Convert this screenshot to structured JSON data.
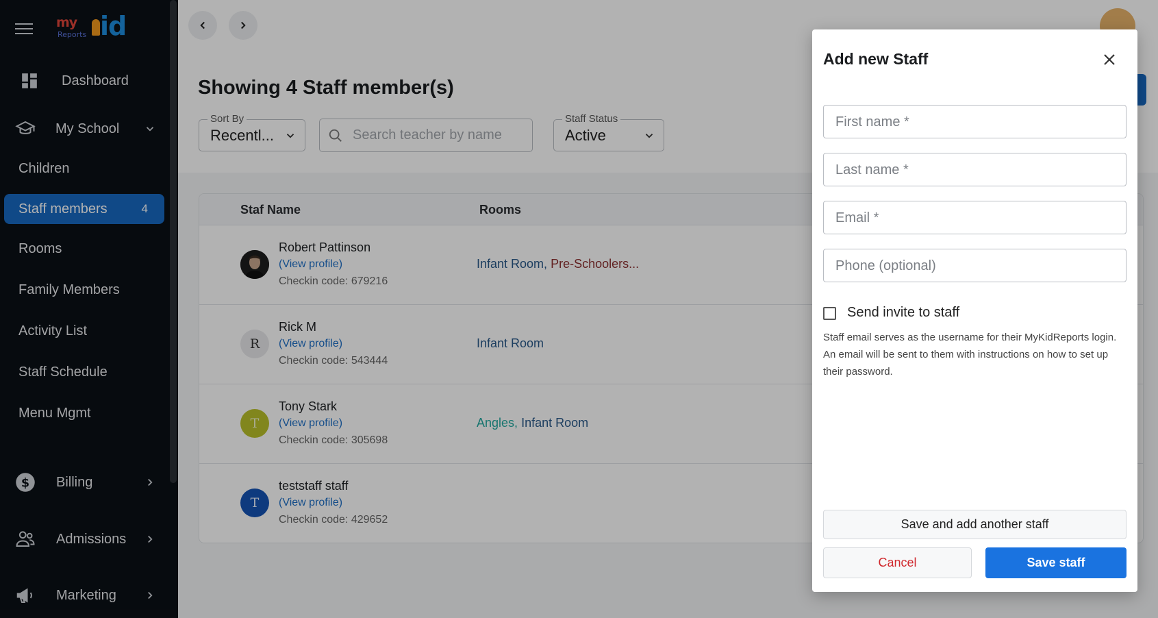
{
  "sidebar": {
    "brand": {
      "my": "my",
      "reports": "Reports",
      "kid": "id"
    },
    "items": [
      {
        "label": "Dashboard",
        "icon": "dashboard-icon"
      },
      {
        "label": "My School",
        "icon": "school-icon"
      },
      {
        "label": "Billing",
        "icon": "dollar-icon"
      },
      {
        "label": "Admissions",
        "icon": "people-icon"
      },
      {
        "label": "Marketing",
        "icon": "megaphone-icon"
      }
    ],
    "sub_items": [
      {
        "label": "Children"
      },
      {
        "label": "Staff members",
        "count": "4"
      },
      {
        "label": "Rooms"
      },
      {
        "label": "Family Members"
      },
      {
        "label": "Activity List"
      },
      {
        "label": "Staff Schedule"
      },
      {
        "label": "Menu Mgmt"
      }
    ]
  },
  "main": {
    "title": "Showing 4 Staff member(s)",
    "sort": {
      "label": "Sort By",
      "value": "Recentl..."
    },
    "search": {
      "placeholder": "Search teacher by name"
    },
    "status": {
      "label": "Staff Status",
      "value": "Active"
    },
    "table": {
      "headers": [
        "Staf Name",
        "Rooms"
      ],
      "rows": [
        {
          "name": "Robert Pattinson",
          "view": "(View profile)",
          "code": "Checkin code: 679216",
          "rooms": [
            "Infant Room,",
            "Pre-Schoolers..."
          ],
          "initial": ""
        },
        {
          "name": "Rick M",
          "view": "(View profile)",
          "code": "Checkin code: 543444",
          "rooms": [
            "Infant Room"
          ],
          "initial": "R"
        },
        {
          "name": "Tony Stark",
          "view": "(View profile)",
          "code": "Checkin code: 305698",
          "rooms": [
            "Angles,",
            "Infant Room"
          ],
          "initial": "T"
        },
        {
          "name": "teststaff staff",
          "view": "(View profile)",
          "code": "Checkin code: 429652",
          "rooms": [],
          "initial": "T"
        }
      ]
    }
  },
  "modal": {
    "title": "Add new Staff",
    "fields": {
      "first_name": "First name *",
      "last_name": "Last name *",
      "email": "Email *",
      "phone": "Phone (optional)"
    },
    "invite_label": "Send invite to staff",
    "note": "Staff email serves as the username for their MyKidReports login. An email will be sent to them with instructions on how to set up their password.",
    "save_another": "Save and add another staff",
    "cancel": "Cancel",
    "save": "Save staff"
  },
  "colors": {
    "sidebar_bg": "#0b1016",
    "accent": "#1769c2",
    "primary_button": "#1a73e0",
    "cancel_text": "#d0282d",
    "link": "#1e6fc6",
    "room_infant": "#2a5a8a",
    "room_preschool": "#8b2e2e",
    "room_angles": "#23a8a0"
  }
}
